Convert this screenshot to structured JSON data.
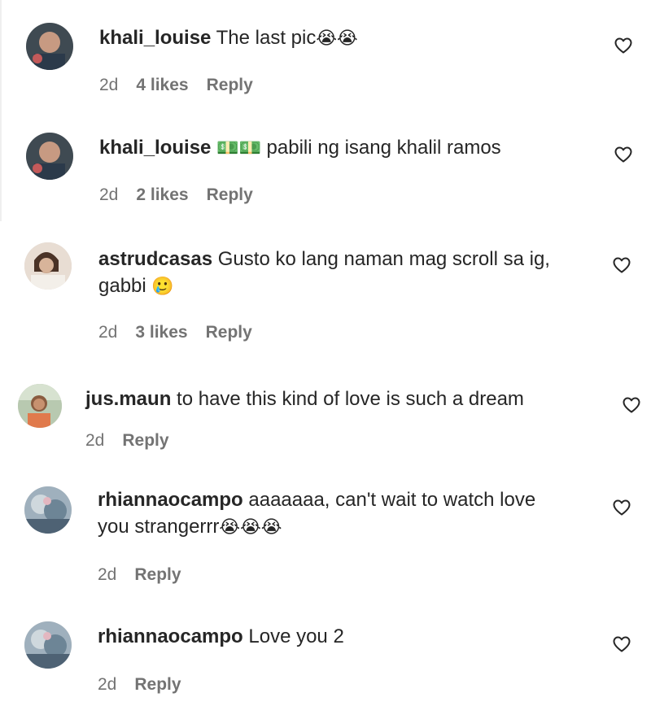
{
  "comments": [
    {
      "username": "khali_louise",
      "text": "The last pic",
      "emoji": "😭😭",
      "time": "2d",
      "likes": "4 likes",
      "reply_label": "Reply"
    },
    {
      "username": "khali_louise",
      "text": "pabili ng isang khalil ramos",
      "emoji": "💵💵",
      "time": "2d",
      "likes": "2 likes",
      "reply_label": "Reply"
    },
    {
      "username": "astrudcasas",
      "text": "Gusto ko lang naman mag scroll sa ig,",
      "text2": "gabbi",
      "emoji": "🥲",
      "time": "2d",
      "likes": "3 likes",
      "reply_label": "Reply"
    },
    {
      "username": "jus.maun",
      "text": "to have this kind of love is such a dream",
      "time": "2d",
      "reply_label": "Reply"
    },
    {
      "username": "rhiannaocampo",
      "text": "aaaaaaa, can't wait to watch love",
      "text2": "you strangerrr",
      "emoji": "😭😭😭",
      "time": "2d",
      "reply_label": "Reply"
    },
    {
      "username": "rhiannaocampo",
      "text": "Love you 2",
      "time": "2d",
      "reply_label": "Reply"
    }
  ],
  "icons": {
    "like": "heart-outline-icon",
    "avatar": "user-avatar"
  },
  "colors": {
    "text": "#262626",
    "meta": "#737373",
    "thread_line": "#efefef"
  }
}
